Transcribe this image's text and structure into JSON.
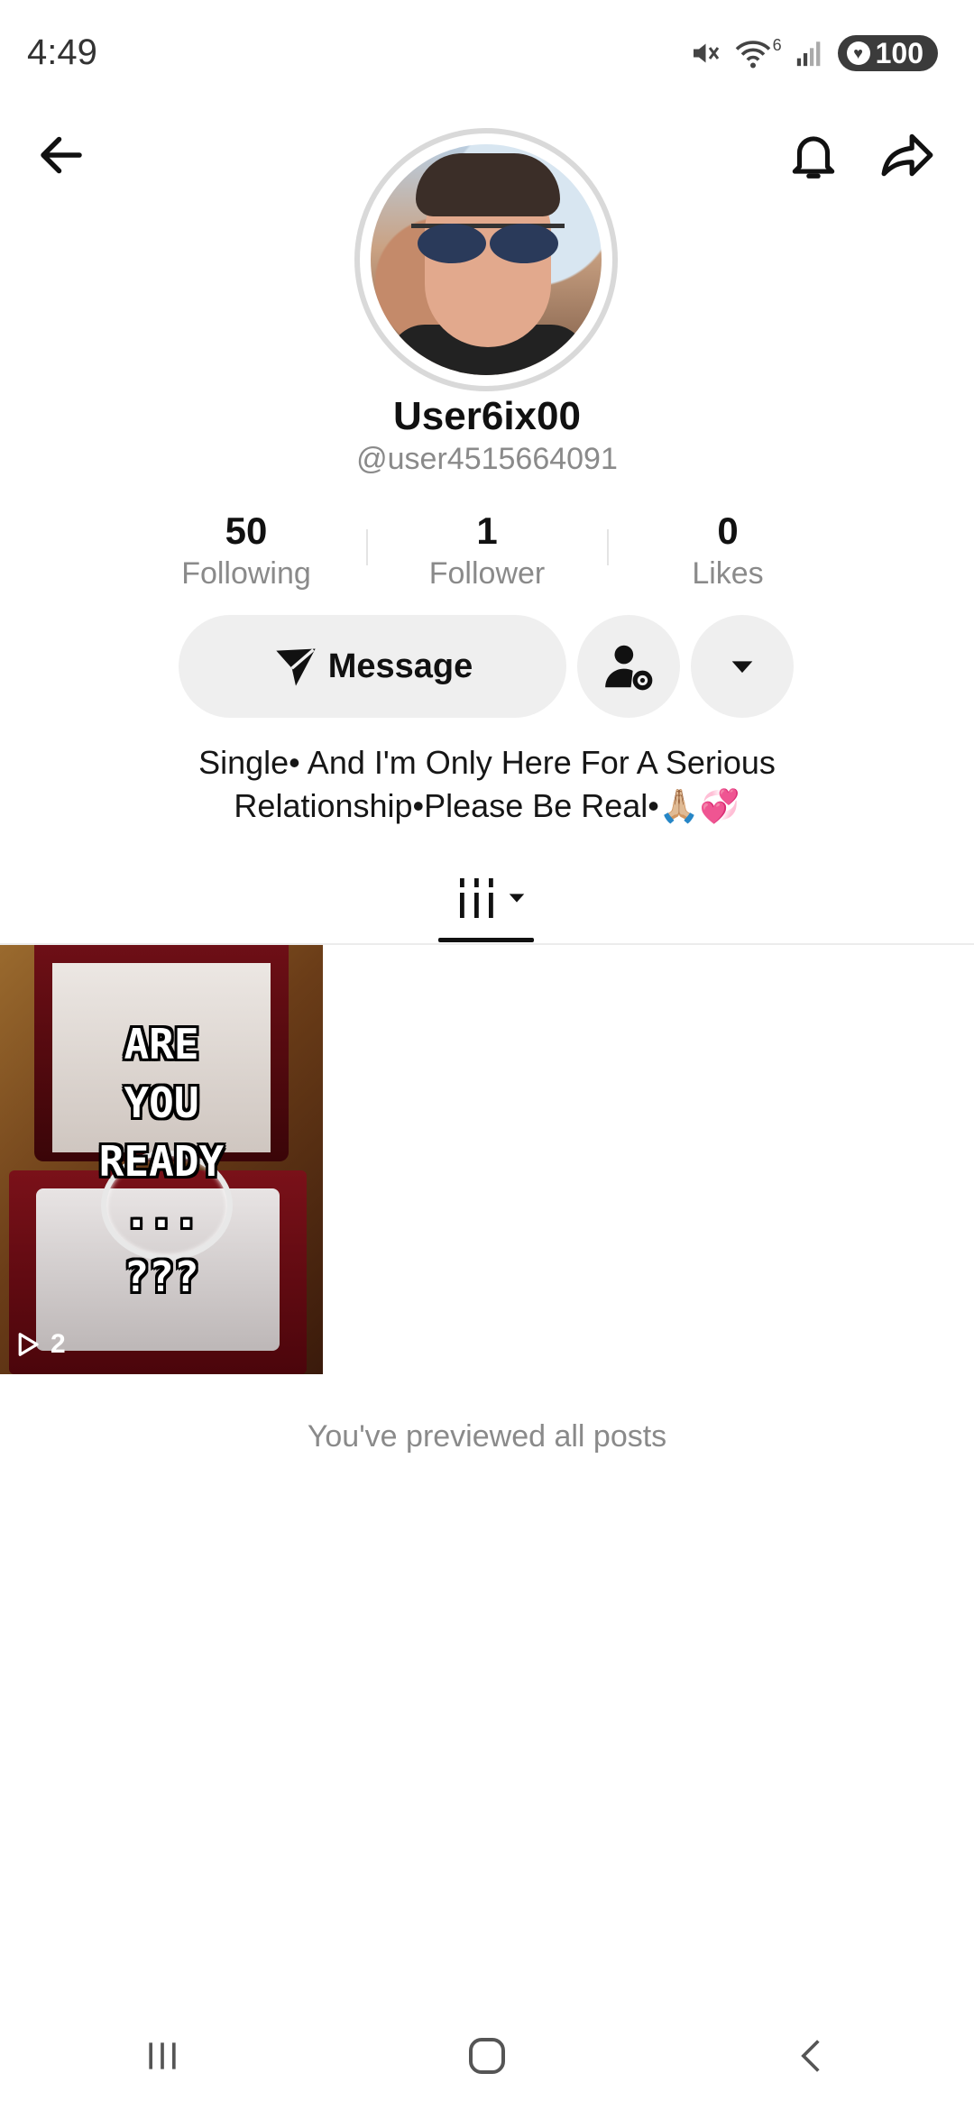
{
  "status_bar": {
    "time": "4:49",
    "battery": "100",
    "signal_sup": "6"
  },
  "profile": {
    "display_name": "User6ix00",
    "handle": "@user4515664091",
    "stats": [
      {
        "value": "50",
        "label": "Following"
      },
      {
        "value": "1",
        "label": "Follower"
      },
      {
        "value": "0",
        "label": "Likes"
      }
    ],
    "message_label": "Message",
    "bio_line1": "Single• And I'm Only Here For A Serious",
    "bio_line2": "Relationship•Please Be Real•🙏🏼💞"
  },
  "posts": [
    {
      "overlay_lines": [
        "ARE",
        "YOU",
        "READY",
        "...",
        "???"
      ],
      "views": "2"
    }
  ],
  "end_message": "You've previewed all posts",
  "icons": {
    "back": "back-arrow-icon",
    "bell": "bell-icon",
    "share": "share-icon",
    "send": "send-icon",
    "user_settings": "user-settings-icon",
    "dropdown": "caret-down-icon",
    "grid": "posts-grid-icon",
    "play": "play-icon"
  }
}
